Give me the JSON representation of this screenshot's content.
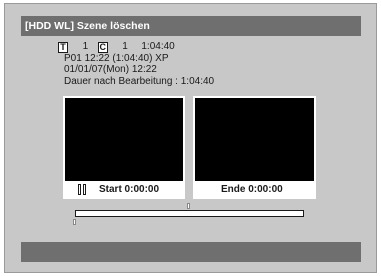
{
  "title": "[HDD WL] Szene löschen",
  "info": {
    "title_badge": "T",
    "title_number": "1",
    "chapter_badge": "C",
    "chapter_number": "1",
    "chapter_duration": "1:04:40",
    "program_line": "P01  12:22 (1:04:40) XP",
    "date_line": "01/01/07(Mon)  12:22",
    "duration_after_edit": "Dauer nach Bearbeitung : 1:04:40"
  },
  "left_panel": {
    "label": "Start  0:00:00"
  },
  "right_panel": {
    "label": "Ende  0:00:00"
  },
  "colors": {
    "background": "#c8c8c8",
    "bar": "#6f6f6f",
    "video": "#000000"
  }
}
